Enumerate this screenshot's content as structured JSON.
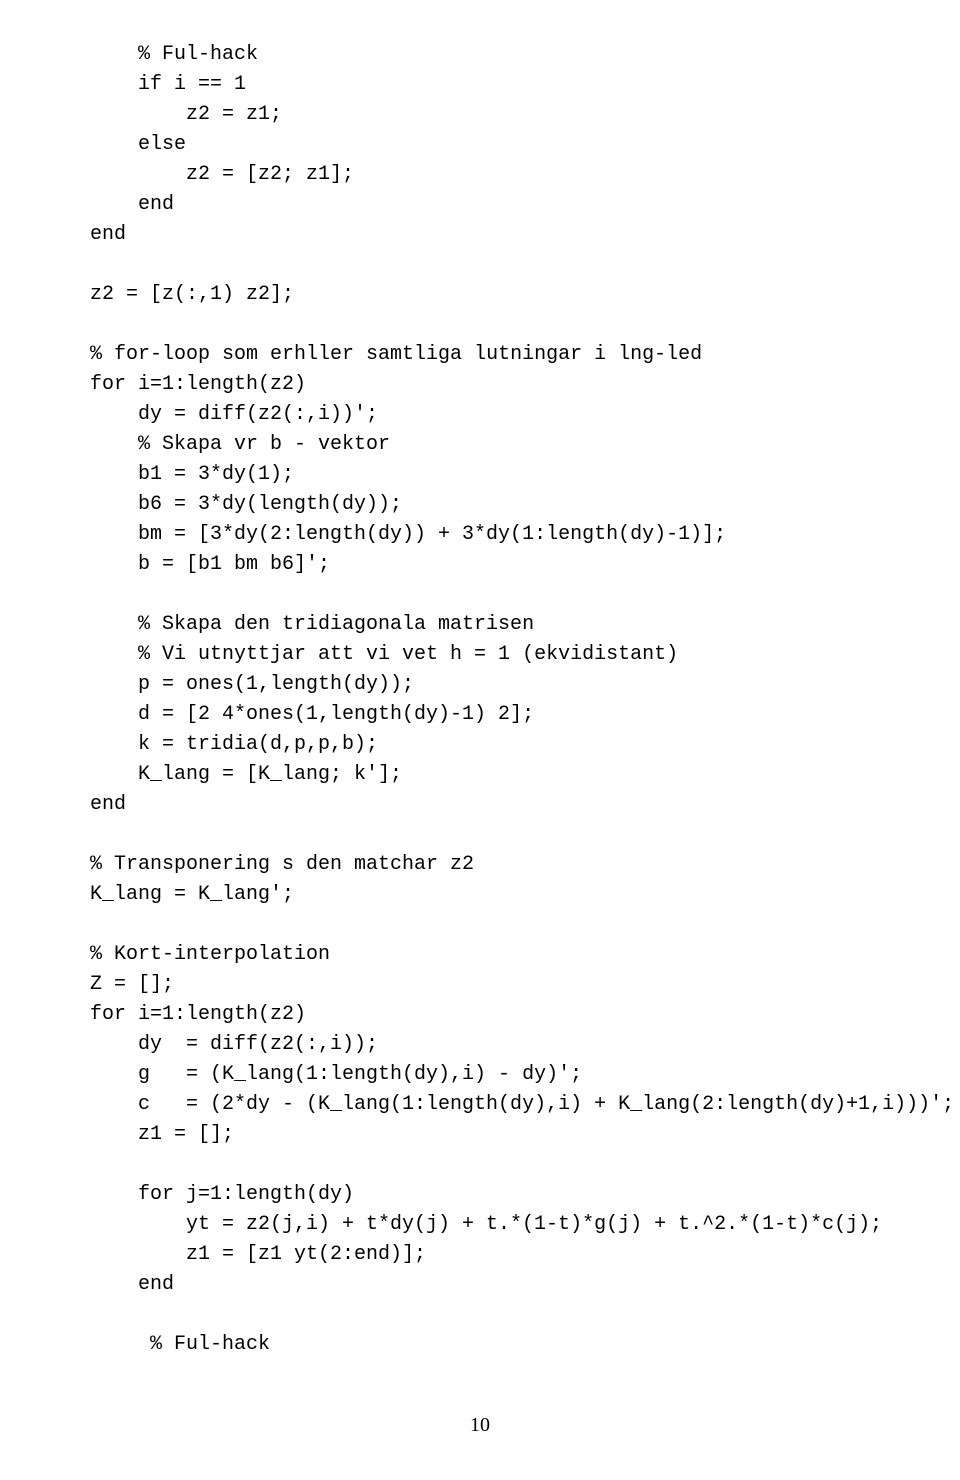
{
  "lines": [
    {
      "cls": "i1",
      "t": "% Ful-hack"
    },
    {
      "cls": "i1",
      "t": "if i == 1"
    },
    {
      "cls": "i2",
      "t": "z2 = z1;"
    },
    {
      "cls": "i1",
      "t": "else"
    },
    {
      "cls": "i2",
      "t": "z2 = [z2; z1];"
    },
    {
      "cls": "i1",
      "t": "end"
    },
    {
      "cls": "i0",
      "t": "end"
    },
    {
      "cls": "blank",
      "t": ""
    },
    {
      "cls": "i0",
      "t": "z2 = [z(:,1) z2];"
    },
    {
      "cls": "blank",
      "t": ""
    },
    {
      "cls": "i0",
      "t": "% for-loop som erhller samtliga lutningar i lng-led"
    },
    {
      "cls": "i0",
      "t": "for i=1:length(z2)"
    },
    {
      "cls": "i1",
      "t": "dy = diff(z2(:,i))';"
    },
    {
      "cls": "i1",
      "t": "% Skapa vr b - vektor"
    },
    {
      "cls": "i1",
      "t": "b1 = 3*dy(1);"
    },
    {
      "cls": "i1",
      "t": "b6 = 3*dy(length(dy));"
    },
    {
      "cls": "i1",
      "t": "bm = [3*dy(2:length(dy)) + 3*dy(1:length(dy)-1)];"
    },
    {
      "cls": "i1",
      "t": "b = [b1 bm b6]';"
    },
    {
      "cls": "blank",
      "t": ""
    },
    {
      "cls": "i1",
      "t": "% Skapa den tridiagonala matrisen"
    },
    {
      "cls": "i1",
      "t": "% Vi utnyttjar att vi vet h = 1 (ekvidistant)"
    },
    {
      "cls": "i1",
      "t": "p = ones(1,length(dy));"
    },
    {
      "cls": "i1",
      "t": "d = [2 4*ones(1,length(dy)-1) 2];"
    },
    {
      "cls": "i1",
      "t": "k = tridia(d,p,p,b);"
    },
    {
      "cls": "i1",
      "t": "K_lang = [K_lang; k'];"
    },
    {
      "cls": "i0",
      "t": "end"
    },
    {
      "cls": "blank",
      "t": ""
    },
    {
      "cls": "i0",
      "t": "% Transponering s den matchar z2"
    },
    {
      "cls": "i0",
      "t": "K_lang = K_lang';"
    },
    {
      "cls": "blank",
      "t": ""
    },
    {
      "cls": "i0",
      "t": "% Kort-interpolation"
    },
    {
      "cls": "i0",
      "t": "Z = [];"
    },
    {
      "cls": "i0",
      "t": "for i=1:length(z2)"
    },
    {
      "cls": "i1",
      "t": "dy  = diff(z2(:,i));"
    },
    {
      "cls": "i1",
      "t": "g   = (K_lang(1:length(dy),i) - dy)';"
    },
    {
      "cls": "i1",
      "t": "c   = (2*dy - (K_lang(1:length(dy),i) + K_lang(2:length(dy)+1,i)))';"
    },
    {
      "cls": "i1",
      "t": "z1 = [];"
    },
    {
      "cls": "blank",
      "t": ""
    },
    {
      "cls": "i1",
      "t": "for j=1:length(dy)"
    },
    {
      "cls": "i2",
      "t": "yt = z2(j,i) + t*dy(j) + t.*(1-t)*g(j) + t.^2.*(1-t)*c(j);"
    },
    {
      "cls": "i2",
      "t": "z1 = [z1 yt(2:end)];"
    },
    {
      "cls": "i1",
      "t": "end"
    },
    {
      "cls": "blank",
      "t": ""
    },
    {
      "cls": "i1",
      "t": " % Ful-hack"
    }
  ],
  "pageNumber": "10"
}
